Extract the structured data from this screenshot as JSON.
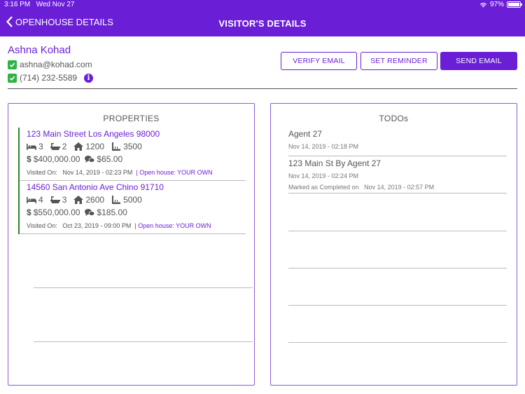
{
  "status_bar": {
    "time": "3:16 PM",
    "date": "Wed Nov 27",
    "battery": "97%",
    "battery_level": 0.97
  },
  "nav": {
    "back_label": "OPENHOUSE DETAILS",
    "title": "VISITOR'S DETAILS"
  },
  "visitor": {
    "name": "Ashna Kohad",
    "email": "ashna@kohad.com",
    "phone": "(714) 232-5589",
    "info_icon": "i"
  },
  "actions": {
    "verify_email": "VERIFY EMAIL",
    "set_reminder": "SET REMINDER",
    "send_email": "SEND EMAIL"
  },
  "colors": {
    "brand": "#6a1fd6",
    "check": "#2fb344",
    "accent_bar": "#2a8a2a"
  },
  "properties": {
    "title": "PROPERTIES",
    "items": [
      {
        "address": "123  Main Street  Los Angeles  98000",
        "beds": "3",
        "baths": "2",
        "sqft": "1200",
        "lot": "3500",
        "price": "$400,000.00",
        "commission": "$65.00",
        "visited_label": "Visited On:",
        "visited_on": "Nov 14, 2019 - 02:23 PM",
        "open_house": "| Open house: YOUR OWN"
      },
      {
        "address": "14560  San Antonio Ave  Chino  91710",
        "beds": "4",
        "baths": "3",
        "sqft": "2600",
        "lot": "5000",
        "price": "$550,000.00",
        "commission": "$185.00",
        "visited_label": "Visited On:",
        "visited_on": "Oct 23, 2019 - 09:00 PM",
        "open_house": "| Open house: YOUR OWN"
      }
    ]
  },
  "todos": {
    "title": "TODOs",
    "items": [
      {
        "title": "Agent 27",
        "time": "Nov 14, 2019 - 02:18 PM"
      },
      {
        "title": "123 Main St By Agent 27",
        "time": "Nov 14, 2019 - 02:24 PM",
        "completed_label": "Marked as Completed on",
        "completed_on": "Nov 14, 2019 - 02:57 PM"
      }
    ]
  }
}
